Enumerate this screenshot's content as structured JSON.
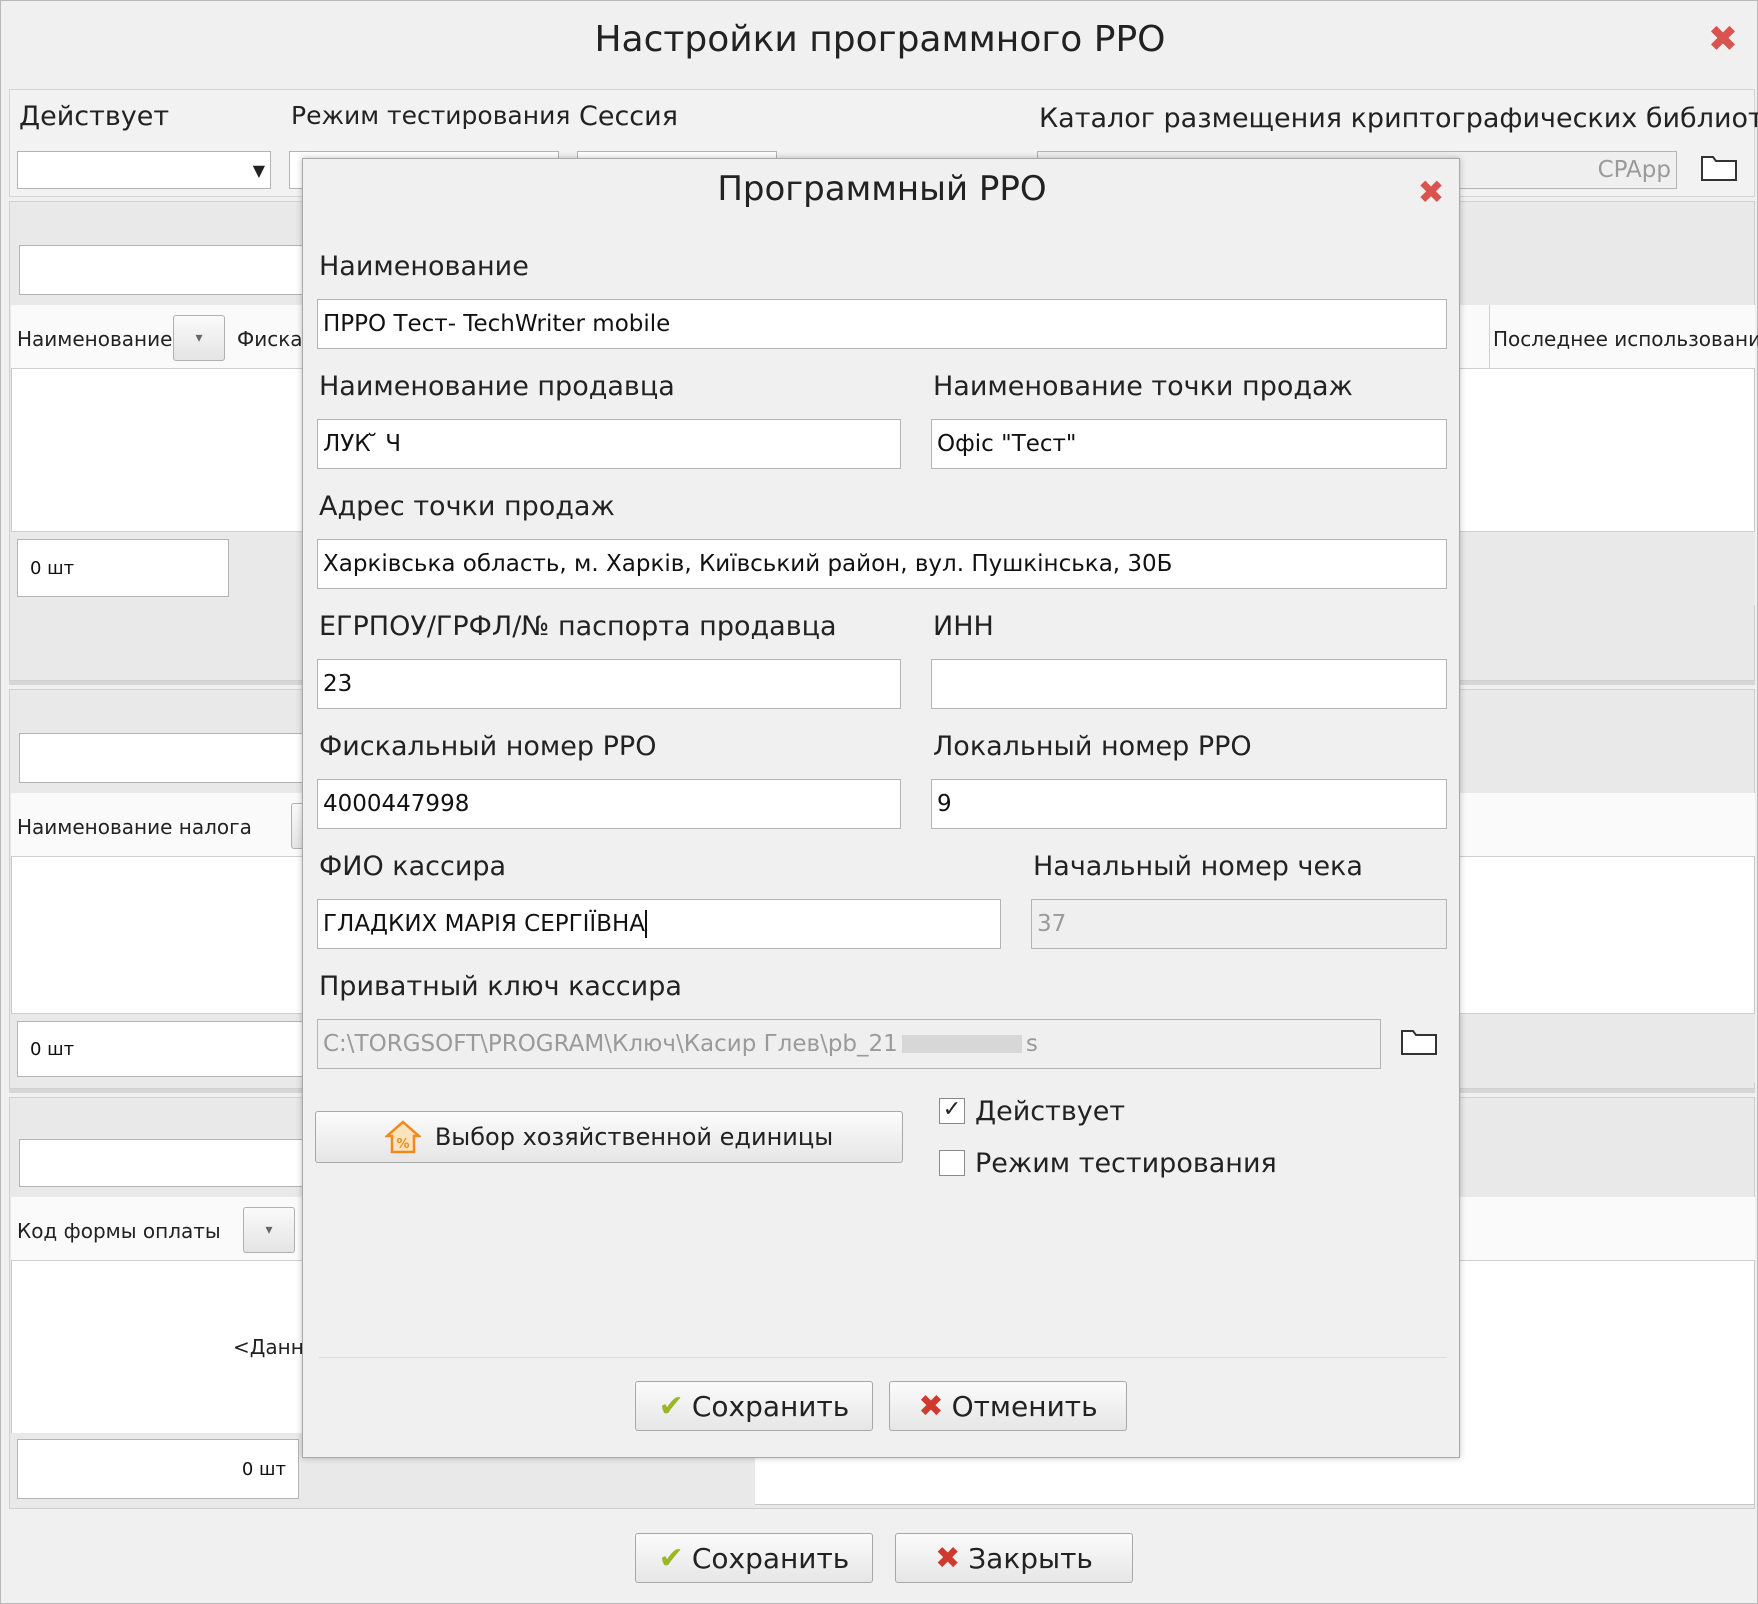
{
  "main": {
    "title": "Настройки программного РРО",
    "filters": {
      "active_label": "Действует",
      "test_mode_label": "Режим тестирования",
      "session_label": "Сессия",
      "crypto_label": "Каталог размещения криптографических библиотек",
      "crypto_value": "CPApp"
    },
    "grid1": {
      "col_name": "Наименование",
      "col_fiscal": "Фискал",
      "col_last_used": "Последнее использование",
      "count": "0 шт"
    },
    "grid2": {
      "col_tax": "Наименование налога",
      "count": "0 шт"
    },
    "grid3": {
      "col_payment": "Код формы оплаты",
      "no_data": "<Данны",
      "count": "0 шт"
    },
    "buttons": {
      "save": "Сохранить",
      "close": "Закрыть"
    }
  },
  "dialog": {
    "title": "Программный РРО",
    "name_label": "Наименование",
    "name_value": "ПРРО Тест- TechWriter mobile",
    "seller_label": "Наименование продавца",
    "seller_value": "ЛУК                  ̆                  Ч",
    "point_label": "Наименование точки продаж",
    "point_value": "Офіс \"Тест\"",
    "address_label": "Адрес точки продаж",
    "address_value": "Харківська область, м. Харків, Київський район, вул. Пушкінська, 30Б",
    "egrpou_label": "ЕГРПОУ/ГРФЛ/№ паспорта продавца",
    "egrpou_value": "23",
    "inn_label": "ИНН",
    "inn_value": "",
    "fiscal_label": "Фискальный номер РРО",
    "fiscal_value": "4000447998",
    "local_label": "Локальный номер РРО",
    "local_value": "9",
    "cashier_label": "ФИО кассира",
    "cashier_value": "ГЛАДКИХ МАРІЯ СЕРГІЇВНА",
    "receipt_label": "Начальный номер чека",
    "receipt_value": "37",
    "key_label": "Приватный ключ кассира",
    "key_value": "C:\\TORGSOFT\\PROGRAM\\Ключ\\Касир Глев\\pb_21",
    "key_tail": "s",
    "unit_button": "Выбор хозяйственной единицы",
    "active_check_label": "Действует",
    "active_checked": true,
    "test_check_label": "Режим тестирования",
    "test_checked": false,
    "save": "Сохранить",
    "cancel": "Отменить"
  }
}
